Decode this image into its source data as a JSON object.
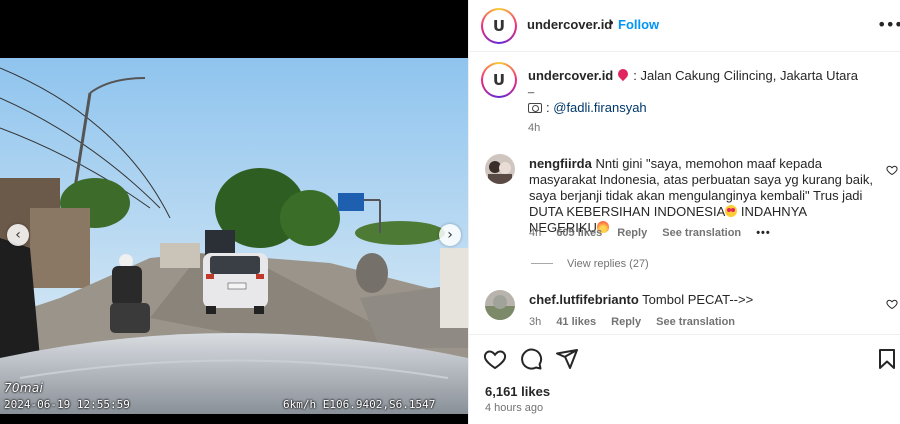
{
  "media": {
    "osd_brand": "70mai",
    "osd_timestamp": "2024-06-19 12:55:59",
    "osd_gps": "6km/h E106.9402,S6.1547",
    "prev_arrow": "‹",
    "next_arrow": "›"
  },
  "header": {
    "username": "undercover.id",
    "separator": "•",
    "follow_label": "Follow",
    "more_label": "•••",
    "avatar_letter": "U"
  },
  "caption": {
    "username": "undercover.id",
    "location_text": ": Jalan Cakung Cilincing, Jakarta Utara",
    "dash": "_",
    "credit_prefix": ":",
    "credit_mention": "@fadli.firansyah",
    "time": "4h"
  },
  "comments": [
    {
      "username": "nengfiirda",
      "text_part1": "Nnti gini \"saya, memohon maaf kepada masyarakat Indonesia, atas perbuatan saya yg kurang baik, saya berjanji tidak akan mengulanginya kembali\" Trus jadi DUTA KEBERSIHAN INDONESIA",
      "text_part2": " INDAHNYA NEGERIKU",
      "time": "4h",
      "likes": "605 likes",
      "reply": "Reply",
      "translate": "See translation",
      "more": "•••",
      "view_replies": "View replies (27)"
    },
    {
      "username": "chef.lutfifebrianto",
      "text": "Tombol PECAT-->>",
      "time": "3h",
      "likes": "41 likes",
      "reply": "Reply",
      "translate": "See translation"
    }
  ],
  "footer": {
    "likes": "6,161 likes",
    "time": "4 hours ago"
  },
  "colors": {
    "accent_blue": "#0095f6",
    "mention_blue": "#00376b",
    "muted": "#737373",
    "text": "#262626"
  },
  "icons": [
    "chevron-left-icon",
    "chevron-right-icon",
    "more-icon",
    "location-pin-icon",
    "camera-icon",
    "heart-icon",
    "comment-icon",
    "share-icon",
    "bookmark-icon",
    "heart-eyes-emoji",
    "fire-emoji"
  ]
}
